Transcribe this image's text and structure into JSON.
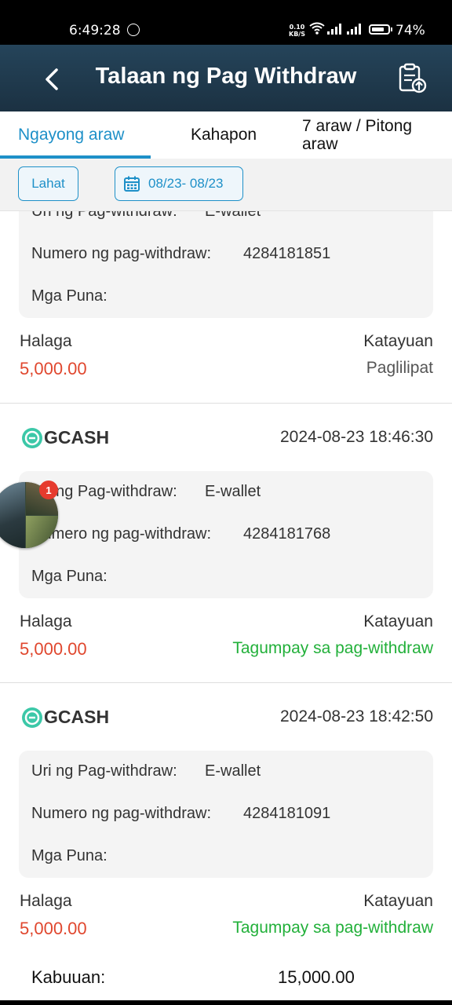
{
  "status_bar": {
    "time": "6:49:28",
    "net_speed_value": "0.10",
    "net_speed_unit": "KB/S",
    "battery": "74%"
  },
  "header": {
    "title": "Talaan ng Pag Withdraw"
  },
  "tabs": [
    {
      "label": "Ngayong araw",
      "active": true
    },
    {
      "label": "Kahapon",
      "active": false
    },
    {
      "label": "7 araw / Pitong araw",
      "active": false
    }
  ],
  "filters": {
    "all_label": "Lahat",
    "date_range": "08/23- 08/23"
  },
  "labels": {
    "type": "Uri ng Pag-withdraw",
    "number": "Numero ng pag-withdraw",
    "remarks": "Mga Puna",
    "amount": "Halaga",
    "status": "Katayuan",
    "colon": ":"
  },
  "records": [
    {
      "brand": "",
      "datetime": "",
      "type": "E-wallet",
      "number": "4284181851",
      "remarks": "",
      "amount": "5,000.00",
      "status": "Paglilipat",
      "status_color": "#555555"
    },
    {
      "brand": "GCASH",
      "datetime": "2024-08-23 18:46:30",
      "type": "E-wallet",
      "number": "4284181768",
      "remarks": "",
      "amount": "5,000.00",
      "status": "Tagumpay sa pag-withdraw",
      "status_color": "#22b03a"
    },
    {
      "brand": "GCASH",
      "datetime": "2024-08-23 18:42:50",
      "type": "E-wallet",
      "number": "4284181091",
      "remarks": "",
      "amount": "5,000.00",
      "status": "Tagumpay sa pag-withdraw",
      "status_color": "#22b03a"
    }
  ],
  "total": {
    "label": "Kabuuan:",
    "value": "15,000.00"
  },
  "floating_chat": {
    "badge_count": "1"
  },
  "colors": {
    "accent": "#1e90c8",
    "amount": "#e0472e",
    "success": "#22b03a",
    "header": "#1f3a4d"
  }
}
